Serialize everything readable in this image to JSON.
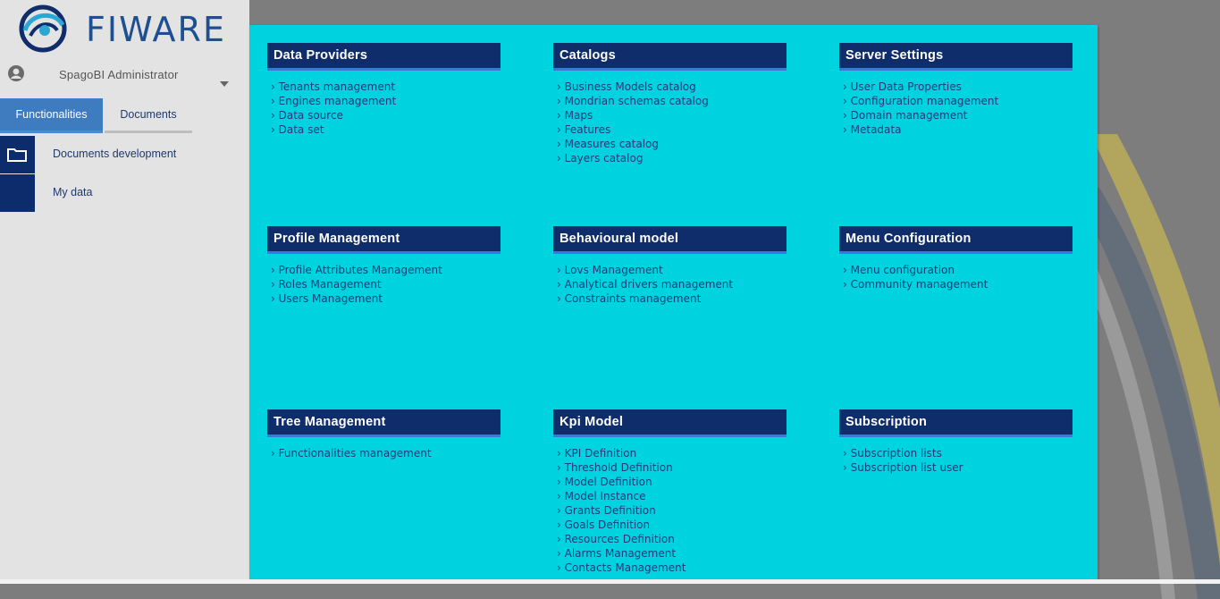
{
  "app": {
    "logo_text": "FIWARE",
    "user_name": "SpagoBI Administrator"
  },
  "tabs": [
    {
      "label": "Functionalities",
      "active": true
    },
    {
      "label": "Documents",
      "active": false
    }
  ],
  "sidebar_items": [
    {
      "label": "Documents development",
      "icon": "folder-icon"
    },
    {
      "label": "My data",
      "icon": "data-icon"
    }
  ],
  "colors": {
    "panel_bg": "#00d3e0",
    "header_bg": "#0f2d6a",
    "header_accent": "#3a7ad6",
    "link": "#1f3c7a",
    "sidebar_bg": "#e3e3e3",
    "tab_active": "#3f7bbf"
  },
  "sections": [
    {
      "title": "Data Providers",
      "items": [
        "Tenants management",
        "Engines management",
        "Data source",
        "Data set"
      ]
    },
    {
      "title": "Catalogs",
      "items": [
        "Business Models catalog",
        "Mondrian schemas catalog",
        "Maps",
        "Features",
        "Measures catalog",
        "Layers catalog"
      ]
    },
    {
      "title": "Server Settings",
      "items": [
        "User Data Properties",
        "Configuration management",
        "Domain management",
        "Metadata"
      ]
    },
    {
      "title": "Profile Management",
      "items": [
        "Profile Attributes Management",
        "Roles Management",
        "Users Management"
      ]
    },
    {
      "title": "Behavioural model",
      "items": [
        "Lovs Management",
        "Analytical drivers management",
        "Constraints management"
      ]
    },
    {
      "title": "Menu Configuration",
      "items": [
        "Menu configuration",
        "Community management"
      ]
    },
    {
      "title": "Tree Management",
      "items": [
        "Functionalities management"
      ]
    },
    {
      "title": "Kpi Model",
      "items": [
        "KPI Definition",
        "Threshold Definition",
        "Model Definition",
        "Model Instance",
        "Grants Definition",
        "Goals Definition",
        "Resources Definition",
        "Alarms Management",
        "Contacts Management"
      ]
    },
    {
      "title": "Subscription",
      "items": [
        "Subscription lists",
        "Subscription list user"
      ]
    }
  ]
}
